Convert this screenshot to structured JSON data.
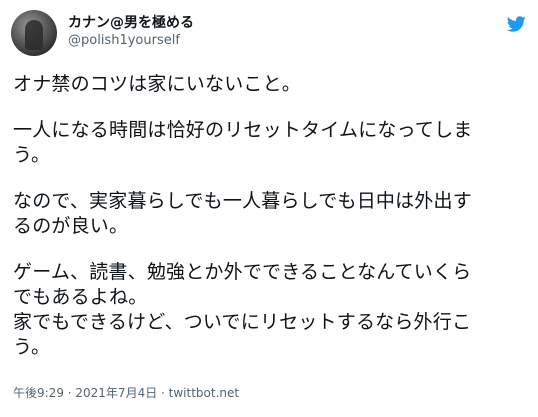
{
  "author": {
    "display_name": "カナン@男を極める",
    "handle": "@polish1yourself"
  },
  "icons": {
    "avatar": "profile-photo",
    "brand": "twitter-bird-icon",
    "brand_color": "#1d9bf0"
  },
  "tweet": {
    "paragraphs": [
      [
        "オナ禁のコツは家にいないこと。"
      ],
      [
        "一人になる時間は恰好のリセットタイムになってしま",
        "う。"
      ],
      [
        "なので、実家暮らしでも一人暮らしでも日中は外出す",
        "るのが良い。"
      ],
      [
        "ゲーム、読書、勉強とか外でできることなんていくら",
        "でもあるよね。",
        "家でもできるけど、ついでにリセットするなら外行こ",
        "う。"
      ]
    ]
  },
  "meta": {
    "timestamp": "午後9:29 · 2021年7月4日 · twittbot.net"
  }
}
